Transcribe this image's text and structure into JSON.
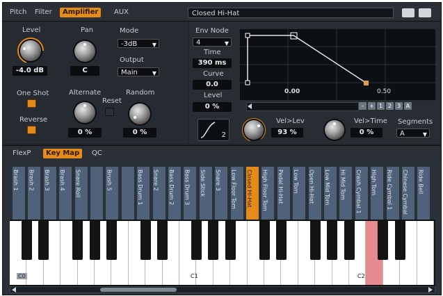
{
  "top_tabs": [
    {
      "label": "Pitch",
      "active": false
    },
    {
      "label": "Filter",
      "active": false
    },
    {
      "label": "Amplifier",
      "active": true
    },
    {
      "label": "AUX",
      "active": false
    }
  ],
  "preset_name": "Closed Hi-Hat",
  "amp": {
    "level_label": "Level",
    "level_value": "-4.0 dB",
    "pan_label": "Pan",
    "pan_value": "C",
    "mode_label": "Mode",
    "mode_value": "-3dB",
    "output_label": "Output",
    "output_value": "Main",
    "one_shot_label": "One Shot",
    "reverse_label": "Reverse",
    "alternate_label": "Alternate",
    "alternate_value": "0 %",
    "reset_label": "Reset",
    "random_label": "Random",
    "random_value": "0 %"
  },
  "env": {
    "node_label": "Env Node",
    "node_value": "4",
    "time_label": "Time",
    "time_value": "390 ms",
    "curve_label": "Curve",
    "curve_value": "0.0",
    "level_label": "Level",
    "level_value": "0 %",
    "tick_0": "0.00",
    "tick_1": "0.50",
    "seg_buttons": [
      "–",
      "+",
      "1",
      "2",
      "3",
      "A"
    ],
    "shape_num": "2",
    "vel_lev_label": "Vel>Lev",
    "vel_lev_value": "93 %",
    "vel_time_label": "Vel>Time",
    "vel_time_value": "0 %",
    "segments_label": "Segments",
    "segments_value": "A"
  },
  "lower_tabs": [
    {
      "label": "FlexP",
      "active": false
    },
    {
      "label": "Key Map",
      "active": true
    },
    {
      "label": "QC",
      "active": false
    }
  ],
  "key_columns": [
    "Brash 1",
    "Brash 2",
    "Brash 3",
    "Brash 4",
    "Snare Roll",
    "",
    "Brush 5",
    "",
    "Bass Drum 1",
    "Snare 2",
    "Bass Drum 2",
    "Bass Drum 3",
    "Side Stick",
    "Snare 3",
    "Low Floor Tom",
    "Closed Hi-Hat",
    "High Floor Tom",
    "Pedal Hi-Hat",
    "Low Tom",
    "Open Hi-Hat",
    "Low Mid Tom",
    "Hi Mid Tom",
    "Crash Cymbal 1",
    "High Tom",
    "Ride Cymbal 1",
    "Chinese Cymbal",
    "Ride Bell"
  ],
  "highlight_column": "Closed Hi-Hat",
  "octave_labels": {
    "c0": "C0",
    "c1": "C1",
    "c2": "C2"
  },
  "pressed_key_color": "#e58a8f",
  "accent_color": "#e48b1c"
}
